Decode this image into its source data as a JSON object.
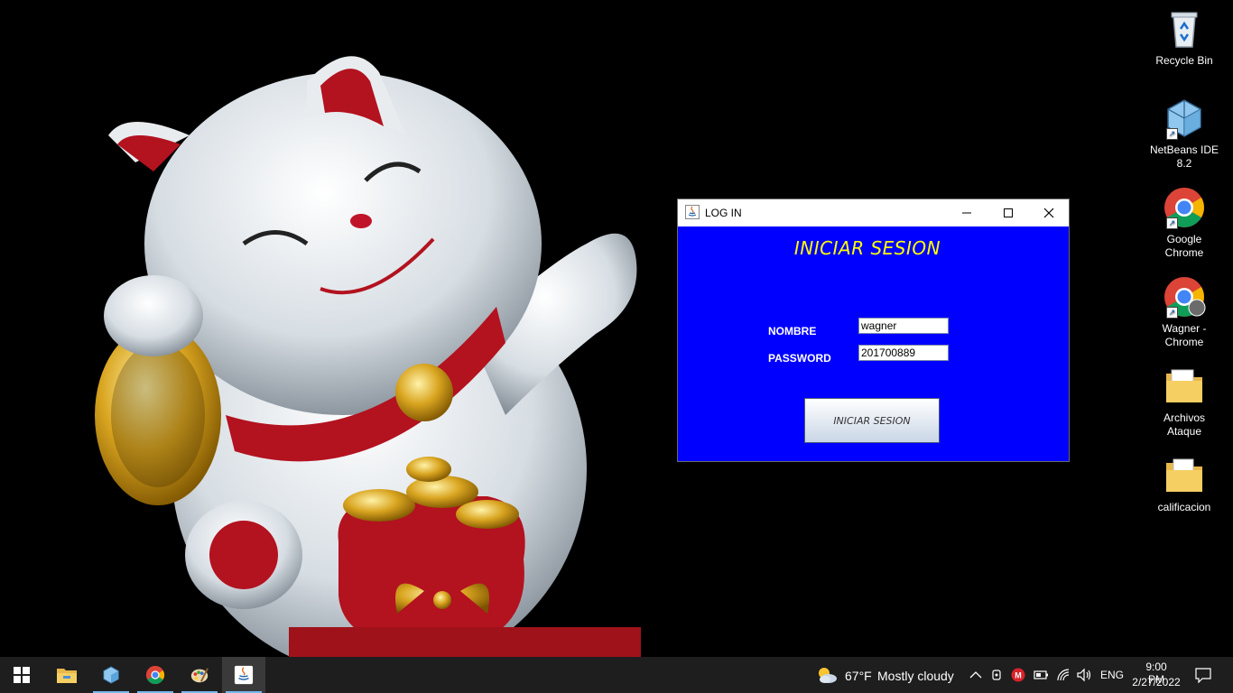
{
  "desktop_icons": [
    {
      "label": "Recycle Bin",
      "icon": "recycle-bin-icon"
    },
    {
      "label": "NetBeans IDE 8.2",
      "icon": "netbeans-icon"
    },
    {
      "label": "Google Chrome",
      "icon": "chrome-icon"
    },
    {
      "label": "Wagner - Chrome",
      "icon": "chrome-profile-icon"
    },
    {
      "label": "Archivos Ataque",
      "icon": "folder-icon"
    },
    {
      "label": "calificacion",
      "icon": "folder-icon"
    }
  ],
  "window": {
    "title": "LOG IN",
    "heading": "INICIAR SESION",
    "nombre_label": "NOMBRE",
    "nombre_value": "wagner",
    "password_label": "PASSWORD",
    "password_value": "201700889",
    "button_label": "INICIAR SESION",
    "bg_color": "#0000ff",
    "heading_color": "#ffff00"
  },
  "taskbar": {
    "weather_temp": "67°F",
    "weather_text": "Mostly cloudy",
    "language": "ENG",
    "time": "9:00 PM",
    "date": "2/27/2022"
  }
}
